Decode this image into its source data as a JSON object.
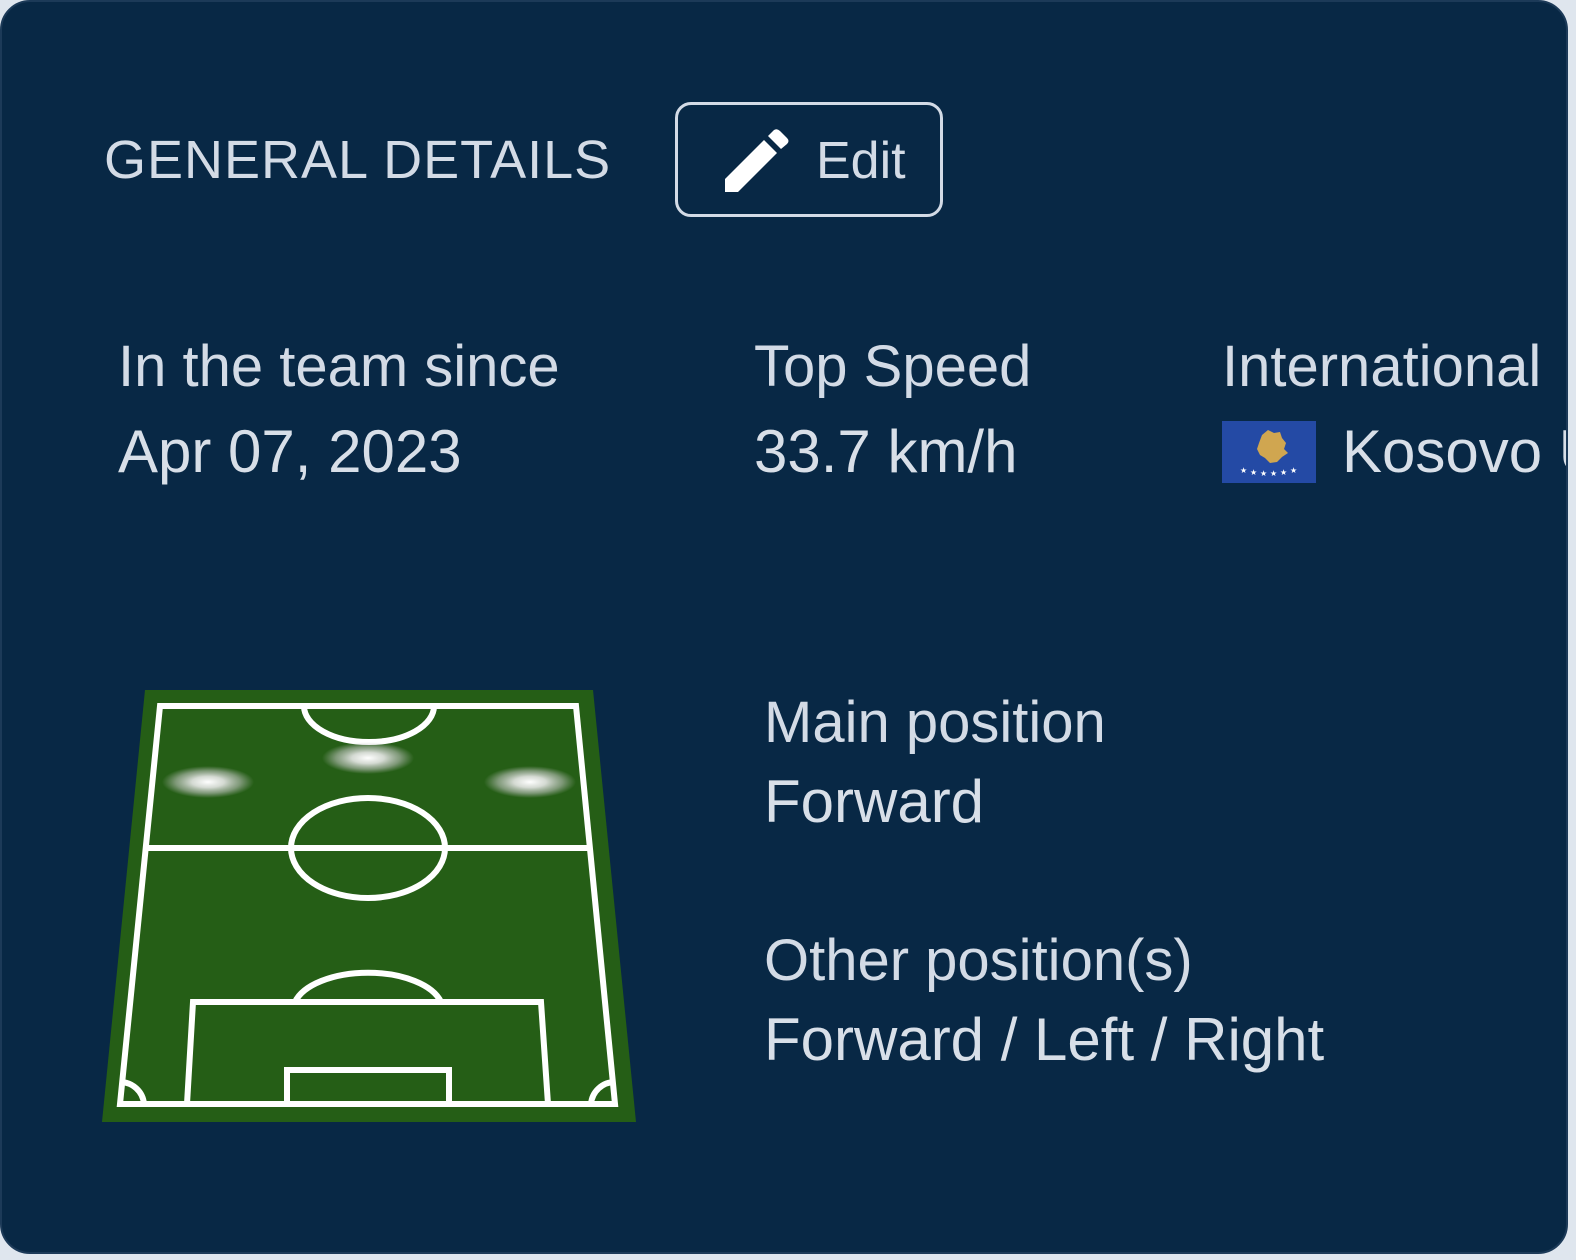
{
  "header": {
    "title": "GENERAL DETAILS",
    "edit_label": "Edit"
  },
  "stats": {
    "team_since": {
      "label": "In the team since",
      "value": "Apr 07, 2023"
    },
    "top_speed": {
      "label": "Top Speed",
      "value": "33.7 km/h"
    },
    "international": {
      "label": "International",
      "value": "Kosovo U",
      "flag": "kosovo-flag-icon"
    }
  },
  "positions": {
    "main": {
      "label": "Main position",
      "value": "Forward"
    },
    "other": {
      "label": "Other position(s)",
      "value": "Forward / Left / Right"
    }
  },
  "colors": {
    "card_bg": "#082845",
    "text": "#d3dbe6",
    "pitch_green": "#255e16",
    "flag_blue": "#244aa5",
    "flag_gold": "#d0a650"
  }
}
